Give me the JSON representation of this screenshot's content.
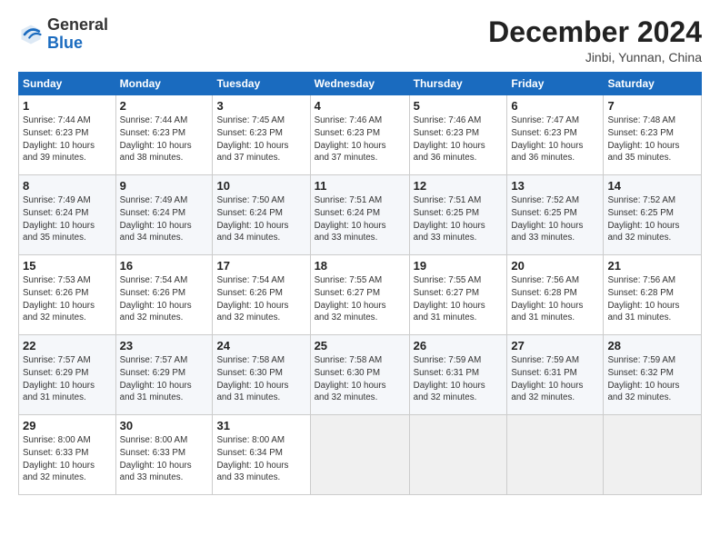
{
  "header": {
    "logo_general": "General",
    "logo_blue": "Blue",
    "month_title": "December 2024",
    "location": "Jinbi, Yunnan, China"
  },
  "weekdays": [
    "Sunday",
    "Monday",
    "Tuesday",
    "Wednesday",
    "Thursday",
    "Friday",
    "Saturday"
  ],
  "weeks": [
    [
      {
        "day": "1",
        "info": "Sunrise: 7:44 AM\nSunset: 6:23 PM\nDaylight: 10 hours\nand 39 minutes."
      },
      {
        "day": "2",
        "info": "Sunrise: 7:44 AM\nSunset: 6:23 PM\nDaylight: 10 hours\nand 38 minutes."
      },
      {
        "day": "3",
        "info": "Sunrise: 7:45 AM\nSunset: 6:23 PM\nDaylight: 10 hours\nand 37 minutes."
      },
      {
        "day": "4",
        "info": "Sunrise: 7:46 AM\nSunset: 6:23 PM\nDaylight: 10 hours\nand 37 minutes."
      },
      {
        "day": "5",
        "info": "Sunrise: 7:46 AM\nSunset: 6:23 PM\nDaylight: 10 hours\nand 36 minutes."
      },
      {
        "day": "6",
        "info": "Sunrise: 7:47 AM\nSunset: 6:23 PM\nDaylight: 10 hours\nand 36 minutes."
      },
      {
        "day": "7",
        "info": "Sunrise: 7:48 AM\nSunset: 6:23 PM\nDaylight: 10 hours\nand 35 minutes."
      }
    ],
    [
      {
        "day": "8",
        "info": "Sunrise: 7:49 AM\nSunset: 6:24 PM\nDaylight: 10 hours\nand 35 minutes."
      },
      {
        "day": "9",
        "info": "Sunrise: 7:49 AM\nSunset: 6:24 PM\nDaylight: 10 hours\nand 34 minutes."
      },
      {
        "day": "10",
        "info": "Sunrise: 7:50 AM\nSunset: 6:24 PM\nDaylight: 10 hours\nand 34 minutes."
      },
      {
        "day": "11",
        "info": "Sunrise: 7:51 AM\nSunset: 6:24 PM\nDaylight: 10 hours\nand 33 minutes."
      },
      {
        "day": "12",
        "info": "Sunrise: 7:51 AM\nSunset: 6:25 PM\nDaylight: 10 hours\nand 33 minutes."
      },
      {
        "day": "13",
        "info": "Sunrise: 7:52 AM\nSunset: 6:25 PM\nDaylight: 10 hours\nand 33 minutes."
      },
      {
        "day": "14",
        "info": "Sunrise: 7:52 AM\nSunset: 6:25 PM\nDaylight: 10 hours\nand 32 minutes."
      }
    ],
    [
      {
        "day": "15",
        "info": "Sunrise: 7:53 AM\nSunset: 6:26 PM\nDaylight: 10 hours\nand 32 minutes."
      },
      {
        "day": "16",
        "info": "Sunrise: 7:54 AM\nSunset: 6:26 PM\nDaylight: 10 hours\nand 32 minutes."
      },
      {
        "day": "17",
        "info": "Sunrise: 7:54 AM\nSunset: 6:26 PM\nDaylight: 10 hours\nand 32 minutes."
      },
      {
        "day": "18",
        "info": "Sunrise: 7:55 AM\nSunset: 6:27 PM\nDaylight: 10 hours\nand 32 minutes."
      },
      {
        "day": "19",
        "info": "Sunrise: 7:55 AM\nSunset: 6:27 PM\nDaylight: 10 hours\nand 31 minutes."
      },
      {
        "day": "20",
        "info": "Sunrise: 7:56 AM\nSunset: 6:28 PM\nDaylight: 10 hours\nand 31 minutes."
      },
      {
        "day": "21",
        "info": "Sunrise: 7:56 AM\nSunset: 6:28 PM\nDaylight: 10 hours\nand 31 minutes."
      }
    ],
    [
      {
        "day": "22",
        "info": "Sunrise: 7:57 AM\nSunset: 6:29 PM\nDaylight: 10 hours\nand 31 minutes."
      },
      {
        "day": "23",
        "info": "Sunrise: 7:57 AM\nSunset: 6:29 PM\nDaylight: 10 hours\nand 31 minutes."
      },
      {
        "day": "24",
        "info": "Sunrise: 7:58 AM\nSunset: 6:30 PM\nDaylight: 10 hours\nand 31 minutes."
      },
      {
        "day": "25",
        "info": "Sunrise: 7:58 AM\nSunset: 6:30 PM\nDaylight: 10 hours\nand 32 minutes."
      },
      {
        "day": "26",
        "info": "Sunrise: 7:59 AM\nSunset: 6:31 PM\nDaylight: 10 hours\nand 32 minutes."
      },
      {
        "day": "27",
        "info": "Sunrise: 7:59 AM\nSunset: 6:31 PM\nDaylight: 10 hours\nand 32 minutes."
      },
      {
        "day": "28",
        "info": "Sunrise: 7:59 AM\nSunset: 6:32 PM\nDaylight: 10 hours\nand 32 minutes."
      }
    ],
    [
      {
        "day": "29",
        "info": "Sunrise: 8:00 AM\nSunset: 6:33 PM\nDaylight: 10 hours\nand 32 minutes."
      },
      {
        "day": "30",
        "info": "Sunrise: 8:00 AM\nSunset: 6:33 PM\nDaylight: 10 hours\nand 33 minutes."
      },
      {
        "day": "31",
        "info": "Sunrise: 8:00 AM\nSunset: 6:34 PM\nDaylight: 10 hours\nand 33 minutes."
      },
      null,
      null,
      null,
      null
    ]
  ]
}
